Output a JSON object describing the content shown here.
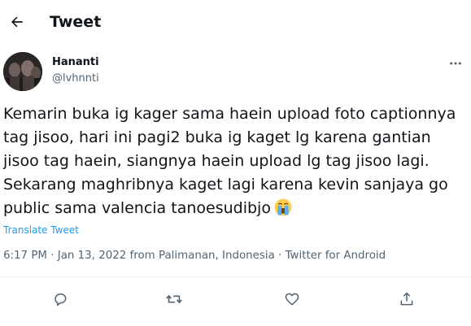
{
  "header": {
    "title": "Tweet",
    "back_icon": "arrow-left-icon"
  },
  "author": {
    "name": "Hananti",
    "handle": "@lvhnnti",
    "more_icon": "more-horizontal-icon"
  },
  "tweet": {
    "text": "Kemarin buka ig kager sama haein upload foto captionnya tag jisoo, hari ini pagi2 buka ig kaget lg karena gantian jisoo tag haein, siangnya haein upload lg tag jisoo lagi. Sekarang maghribnya kaget lagi karena kevin sanjaya go public sama valencia tanoesudibjo",
    "emoji": "loudly-crying-face-emoji",
    "translate_label": "Translate Tweet"
  },
  "meta": {
    "time": "6:17 PM",
    "date": "Jan 13, 2022",
    "location": "from Palimanan, Indonesia",
    "client": "Twitter for Android",
    "separator": " · "
  },
  "actions": [
    "reply-icon",
    "retweet-icon",
    "like-icon",
    "share-icon"
  ],
  "colors": {
    "link": "#1d9bf0",
    "secondary_text": "#536471",
    "divider": "#eff3f4",
    "text": "#0f1419"
  }
}
